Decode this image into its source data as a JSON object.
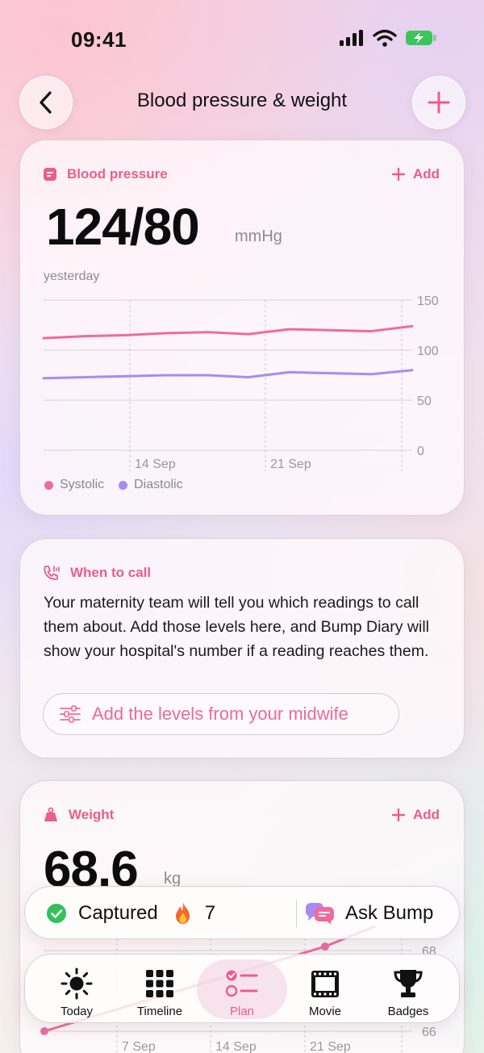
{
  "status_bar": {
    "time": "09:41"
  },
  "header": {
    "title": "Blood pressure & weight"
  },
  "blood_pressure": {
    "title": "Blood pressure",
    "add_label": "Add",
    "value": "124/80",
    "unit": "mmHg",
    "caption": "yesterday",
    "legend": {
      "systolic": "Systolic",
      "diastolic": "Diastolic"
    },
    "colors": {
      "systolic": "#f06b9b",
      "diastolic": "#a68cf2"
    }
  },
  "when_to_call": {
    "title": "When to call",
    "text": "Your maternity team will tell you which readings to call them about. Add those levels here, and Bump Diary will show your hospital's number if a reading reaches them.",
    "button_label": "Add the levels from your midwife"
  },
  "weight": {
    "title": "Weight",
    "add_label": "Add",
    "value": "68.6",
    "unit": "kg"
  },
  "captured_bar": {
    "captured_label": "Captured",
    "streak": "7",
    "ask_label": "Ask Bump"
  },
  "tab_bar": {
    "tabs": [
      {
        "label": "Today",
        "icon": "sun-icon"
      },
      {
        "label": "Timeline",
        "icon": "grid-icon"
      },
      {
        "label": "Plan",
        "icon": "checklist-icon",
        "active": true
      },
      {
        "label": "Movie",
        "icon": "film-icon"
      },
      {
        "label": "Badges",
        "icon": "trophy-icon"
      }
    ]
  },
  "chart_data": [
    {
      "type": "line",
      "x_ticks": [
        "14 Sep",
        "21 Sep"
      ],
      "x": [
        "9 Sep",
        "11 Sep",
        "13 Sep",
        "15 Sep",
        "17 Sep",
        "19 Sep",
        "21 Sep",
        "23 Sep",
        "25 Sep",
        "27 Sep"
      ],
      "series": [
        {
          "name": "Systolic",
          "values": [
            112,
            114,
            115,
            117,
            118,
            116,
            121,
            120,
            119,
            124
          ]
        },
        {
          "name": "Diastolic",
          "values": [
            72,
            73,
            74,
            75,
            75,
            73,
            78,
            77,
            76,
            80
          ]
        }
      ],
      "ylim": [
        0,
        150
      ],
      "y_ticks": [
        0,
        50,
        100,
        150
      ],
      "grid": true
    },
    {
      "type": "line",
      "x_ticks": [
        "7 Sep",
        "14 Sep",
        "21 Sep"
      ],
      "y_ticks": [
        66,
        68
      ],
      "series": [
        {
          "values": [
            66.0,
            68.1,
            68.6
          ]
        }
      ],
      "grid": true
    }
  ]
}
